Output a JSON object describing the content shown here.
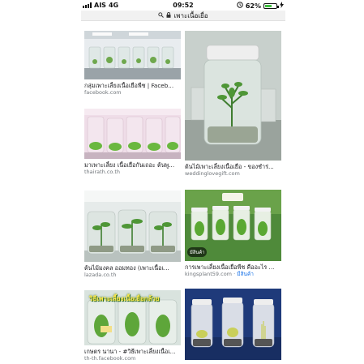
{
  "status_bar": {
    "carrier": "AIS",
    "network": "4G",
    "time": "09:52",
    "battery_percent": "62%",
    "battery_level": 0.62
  },
  "url_bar": {
    "text": "เพาะเนื้อเยื่อ"
  },
  "results": [
    {
      "caption": "กลุ่มเพาะเลี้ยงเนื้อเยื่อพืช | Faceb...",
      "source": "facebook.com"
    },
    {
      "caption": "ต้นไม้เพาะเลี้ยงเนื้อเยื่อ - ของชำร่...",
      "source": "weddinglovegift.com"
    },
    {
      "caption": "มาเพาะเลี้ยง เนื้อเยื่อกันเถอะ ต้นพู...",
      "source": "thairath.co.th"
    },
    {
      "caption": "การเพาะเลี้ยงเนื้อเยื่อพืช คืออะไร ...",
      "source": "kingsplant59.com",
      "source_extra": "มีสินค้า",
      "badge": "มีสินค้า"
    },
    {
      "caption": "ต้นไม้มงคล ออมทอง (เพาะเนื้อเ...",
      "source": "lazada.co.th"
    },
    {
      "caption": "เกษตร นานา - #วิธีเพาะเลี้ยงเนื้อเ...",
      "source": "th-th.facebook.com",
      "overlay": "วิธีเพาะเลี้ยงเนื้อเยื่อกล้วย"
    }
  ],
  "colors": {
    "link_blue": "#1a73e8",
    "source_gray": "#70757a",
    "battery_green": "#3fbf3f"
  },
  "icons": [
    "signal-icon",
    "lock-icon",
    "search-icon",
    "alarm-icon",
    "charging-icon"
  ]
}
